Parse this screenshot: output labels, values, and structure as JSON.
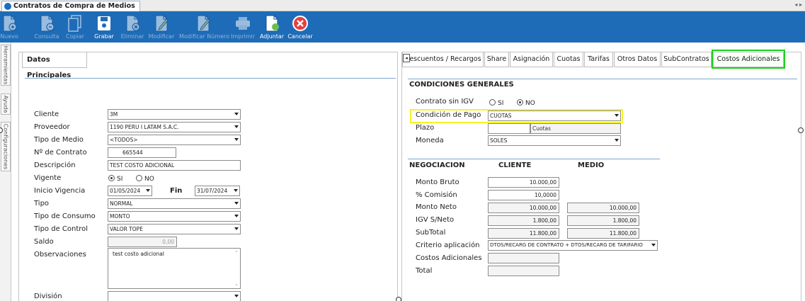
{
  "window": {
    "title": "Contratos de Compra de Medios",
    "nav_arrows": "◂ ▸"
  },
  "colors": {
    "toolbar_bg": "#1e6cb8",
    "active_tab_highlight": "#1ecf1e",
    "field_highlight": "#f5f22a",
    "separator": "#7ea6cf"
  },
  "toolbar": {
    "buttons": [
      {
        "label": "Nuevo",
        "icon": "new-document-icon",
        "enabled": false
      },
      {
        "label": "Consulta",
        "icon": "query-document-icon",
        "enabled": false
      },
      {
        "label": "Copiar",
        "icon": "copy-icon",
        "enabled": false
      },
      {
        "label": "Grabar",
        "icon": "save-icon",
        "enabled": true
      },
      {
        "label": "Eliminar",
        "icon": "delete-document-icon",
        "enabled": false
      },
      {
        "label": "Modificar",
        "icon": "edit-icon",
        "enabled": false
      },
      {
        "label": "Modificar Número",
        "icon": "edit-number-icon",
        "enabled": false
      },
      {
        "label": "Imprimir",
        "icon": "printer-icon",
        "enabled": false
      },
      {
        "label": "Adjuntar",
        "icon": "attach-icon",
        "enabled": true
      },
      {
        "label": "Cancelar",
        "icon": "cancel-icon",
        "enabled": true
      }
    ]
  },
  "side_tabs": [
    "Herramientas",
    "Ayuda",
    "Configuraciones"
  ],
  "left_panel": {
    "tab_label": "Datos Principales",
    "fields": {
      "cliente": {
        "label": "Cliente",
        "value": "3M"
      },
      "proveedor": {
        "label": "Proveedor",
        "value": "1190 PERU I LATAM S.A.C."
      },
      "tipo_medio": {
        "label": "Tipo de Medio",
        "value": "<TODOS>"
      },
      "nro_contrato": {
        "label": "Nº de Contrato",
        "value": "665544"
      },
      "descripcion": {
        "label": "Descripción",
        "value": "TEST COSTO ADICIONAL"
      },
      "vigente": {
        "label": "Vigente",
        "options": [
          "SI",
          "NO"
        ],
        "selected": "SI"
      },
      "inicio_vigencia": {
        "label": "Inicio Vigencia",
        "value": "01/05/2024"
      },
      "fin": {
        "label": "Fin",
        "value": "31/07/2024"
      },
      "tipo": {
        "label": "Tipo",
        "value": "NORMAL"
      },
      "tipo_consumo": {
        "label": "Tipo de Consumo",
        "value": "MONTO"
      },
      "tipo_control": {
        "label": "Tipo de Control",
        "value": "VALOR TOPE"
      },
      "saldo": {
        "label": "Saldo",
        "value": "0,00"
      },
      "observaciones": {
        "label": "Observaciones",
        "value": "test costo adicional"
      },
      "division": {
        "label": "División",
        "value": ""
      }
    }
  },
  "right_panel": {
    "tabs": [
      {
        "label": "Descuentos / Recargos"
      },
      {
        "label": "Share"
      },
      {
        "label": "Asignación"
      },
      {
        "label": "Cuotas"
      },
      {
        "label": "Tarifas"
      },
      {
        "label": "Otros Datos"
      },
      {
        "label": "SubContratos"
      },
      {
        "label": "Costos Adicionales",
        "active": true
      }
    ],
    "condiciones": {
      "header": "CONDICIONES GENERALES",
      "contrato_sin_igv": {
        "label": "Contrato sin IGV",
        "options": [
          "SI",
          "NO"
        ],
        "selected": "NO"
      },
      "condicion_pago": {
        "label": "Condición de Pago",
        "value": "CUOTAS"
      },
      "plazo": {
        "label": "Plazo",
        "value": "",
        "unit": "Cuotas"
      },
      "moneda": {
        "label": "Moneda",
        "value": "SOLES"
      }
    },
    "negociacion": {
      "header": "NEGOCIACION",
      "col_cliente": "CLIENTE",
      "col_medio": "MEDIO",
      "rows": {
        "monto_bruto": {
          "label": "Monto Bruto",
          "cliente": "10.000,00",
          "medio": null
        },
        "comision": {
          "label": "% Comisión",
          "cliente": "10,0000",
          "medio": null
        },
        "monto_neto": {
          "label": "Monto Neto",
          "cliente": "10.000,00",
          "medio": "10.000,00"
        },
        "igv": {
          "label": "IGV S/Neto",
          "cliente": "1.800,00",
          "medio": "1.800,00"
        },
        "subtotal": {
          "label": "SubTotal",
          "cliente": "11.800,00",
          "medio": "11.800,00"
        },
        "criterio": {
          "label": "Criterio aplicación",
          "value": "DTOS/RECARG DE CONTRATO + DTOS/RECARG DE TARIFARIO"
        },
        "costos_adicionales": {
          "label": "Costos Adicionales",
          "cliente": ""
        },
        "total": {
          "label": "Total",
          "cliente": ""
        }
      }
    }
  }
}
